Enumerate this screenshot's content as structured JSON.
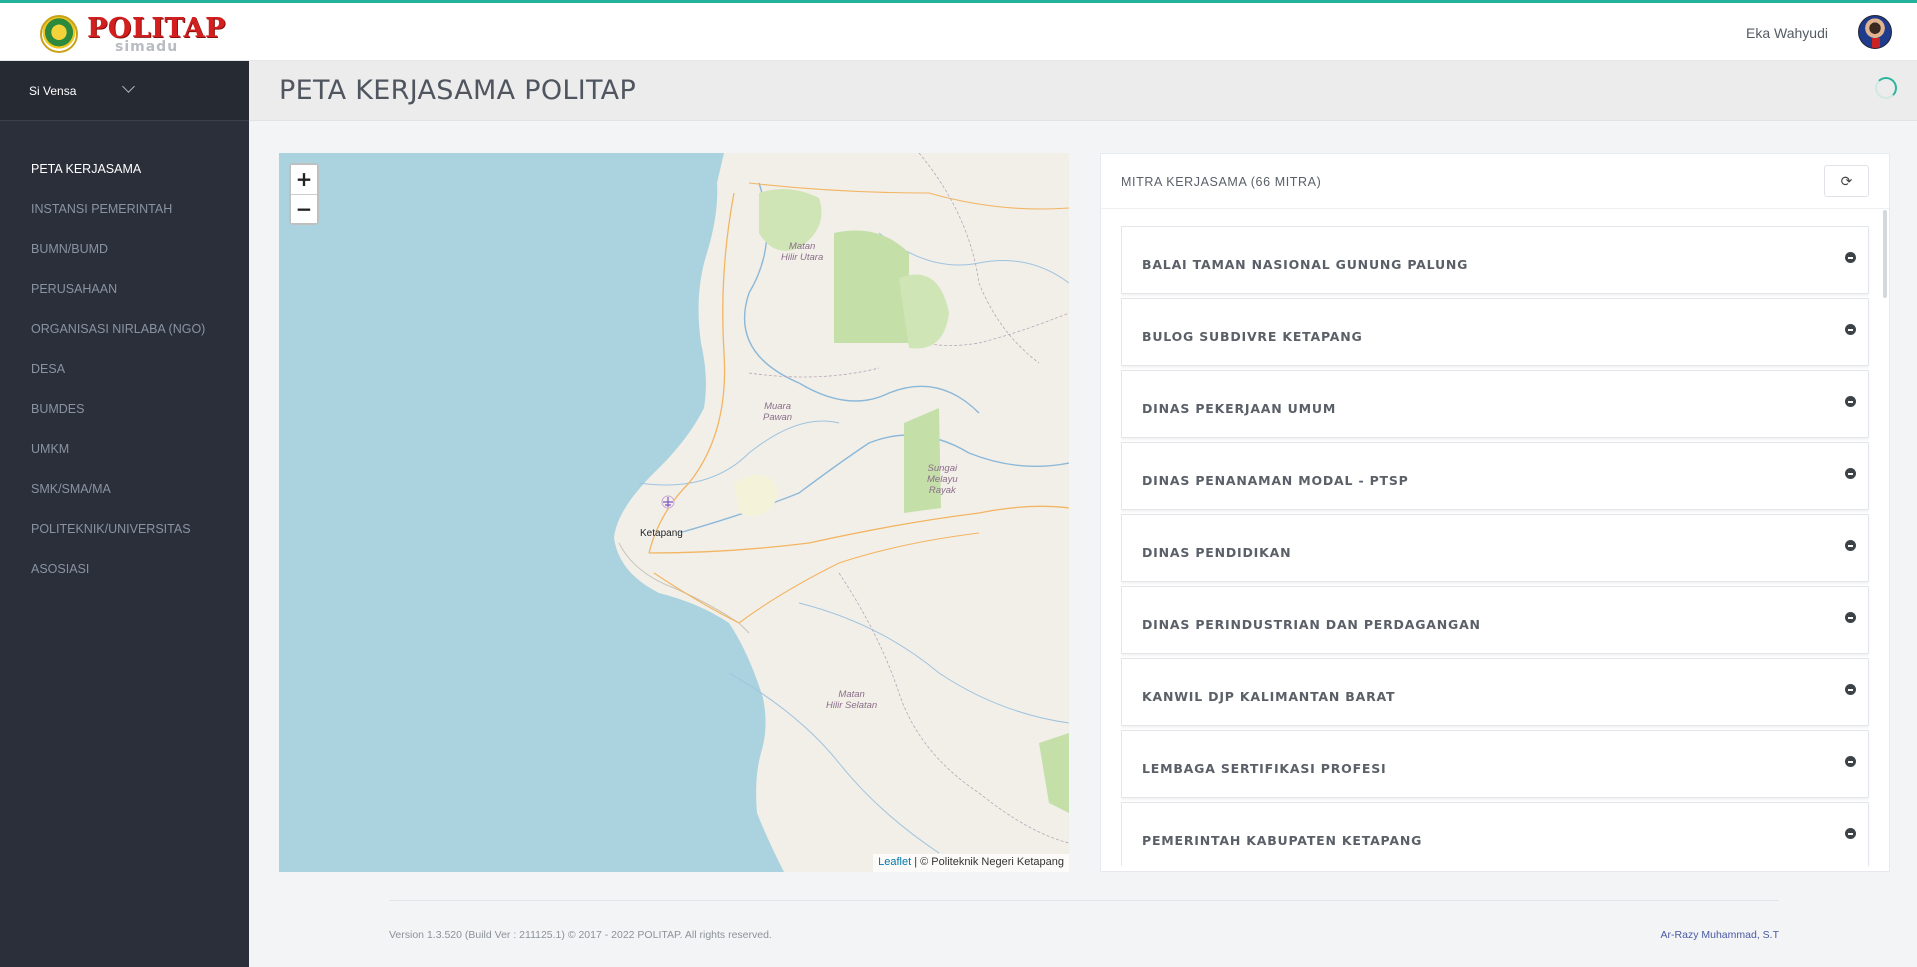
{
  "header": {
    "logo_text": "POLITAP",
    "logo_sub": "simadu",
    "user_name": "Eka Wahyudi"
  },
  "sidebar": {
    "app_switcher": "Si Vensa",
    "items": [
      {
        "label": "PETA KERJASAMA",
        "active": true
      },
      {
        "label": "INSTANSI PEMERINTAH"
      },
      {
        "label": "BUMN/BUMD"
      },
      {
        "label": "PERUSAHAAN"
      },
      {
        "label": "ORGANISASI NIRLABA (NGO)"
      },
      {
        "label": "DESA"
      },
      {
        "label": "BUMDES"
      },
      {
        "label": "UMKM"
      },
      {
        "label": "SMK/SMA/MA"
      },
      {
        "label": "POLITEKNIK/UNIVERSITAS"
      },
      {
        "label": "ASOSIASI"
      }
    ]
  },
  "page": {
    "title": "PETA KERJASAMA POLITAP"
  },
  "map": {
    "zoom_in": "+",
    "zoom_out": "−",
    "attribution_link": "Leaflet",
    "attribution_text": " | © Politeknik Negeri Ketapang",
    "labels": {
      "matan_hilir_utara": "Matan\nHilir Utara",
      "muara_pawan": "Muara\nPawan",
      "sungai_melayu_rayak": "Sungai\nMelayu\nRayak",
      "matan_hilir_selatan": "Matan\nHilir Selatan",
      "ketapang": "Ketapang"
    }
  },
  "mitra": {
    "title": "MITRA KERJASAMA (66 MITRA)",
    "items": [
      "BALAI TAMAN NASIONAL GUNUNG PALUNG",
      "BULOG SUBDIVRE KETAPANG",
      "DINAS PEKERJAAN UMUM",
      "DINAS PENANAMAN MODAL - PTSP",
      "DINAS PENDIDIKAN",
      "DINAS PERINDUSTRIAN DAN PERDAGANGAN",
      "KANWIL DJP KALIMANTAN BARAT",
      "LEMBAGA SERTIFIKASI PROFESI",
      "PEMERINTAH KABUPATEN KETAPANG"
    ]
  },
  "footer": {
    "version": "Version 1.3.520 (Build Ver : 211125.1) © 2017 - 2022 POLITAP. All rights reserved.",
    "author": "Ar-Razy Muhammad, S.T"
  },
  "colors": {
    "accent": "#23b39c",
    "sidebar_bg": "#2b2f3a",
    "logo_red": "#d41f1f",
    "sea": "#aad3df",
    "land": "#f2efe9"
  },
  "icons": {
    "refresh": "refresh-icon",
    "collapse": "minus-circle-icon",
    "app_switch": "chevron-down-icon",
    "airport": "airplane-icon"
  }
}
